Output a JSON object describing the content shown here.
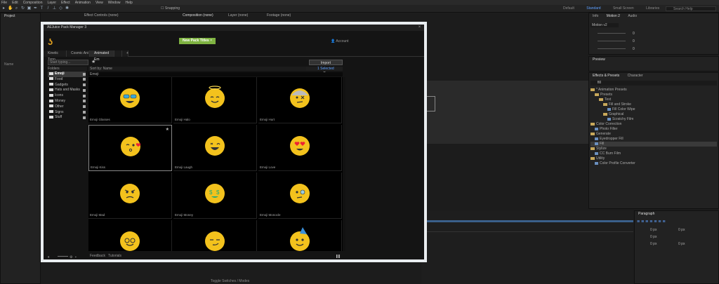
{
  "menu": [
    "File",
    "Edit",
    "Composition",
    "Layer",
    "Effect",
    "Animation",
    "View",
    "Window",
    "Help"
  ],
  "toolbar": {
    "snapping": "Snapping",
    "workspaces": [
      "Default",
      "Standard",
      "Small Screen",
      "Libraries"
    ],
    "search_placeholder": "Search Help"
  },
  "panels": {
    "project_tab": "Project",
    "effect_controls": "Effect Controls (none)",
    "composition": "Composition (none)",
    "layer": "Layer (none)",
    "footage": "Footage (none)",
    "name_col": "Name"
  },
  "info_panel": {
    "tabs": [
      "Info",
      "Motion 2",
      "Audio"
    ],
    "preset": "Motion v2",
    "values": [
      "0",
      "0",
      "0"
    ]
  },
  "preview_panel": {
    "title": "Preview"
  },
  "effects_panel": {
    "tabs": [
      "Effects & Presets",
      "Character"
    ],
    "search": "fill",
    "tree": [
      {
        "label": "* Animation Presets",
        "indent": 0,
        "type": "folder"
      },
      {
        "label": "Presets",
        "indent": 1,
        "type": "folder"
      },
      {
        "label": "Text",
        "indent": 2,
        "type": "folder"
      },
      {
        "label": "Fill and Stroke",
        "indent": 3,
        "type": "folder"
      },
      {
        "label": "Fill Color Wipe",
        "indent": 4,
        "type": "fx"
      },
      {
        "label": "Graphical",
        "indent": 3,
        "type": "folder"
      },
      {
        "label": "Scratchy Film",
        "indent": 4,
        "type": "fx"
      },
      {
        "label": "Color Correction",
        "indent": 0,
        "type": "folder"
      },
      {
        "label": "Photo Filter",
        "indent": 1,
        "type": "fx"
      },
      {
        "label": "Generate",
        "indent": 0,
        "type": "folder"
      },
      {
        "label": "Eyedropper Fill",
        "indent": 1,
        "type": "fx"
      },
      {
        "label": "Fill",
        "indent": 1,
        "type": "fx"
      },
      {
        "label": "Stylize",
        "indent": 0,
        "type": "folder"
      },
      {
        "label": "CC Burn Film",
        "indent": 1,
        "type": "fx"
      },
      {
        "label": "Utility",
        "indent": 0,
        "type": "folder"
      },
      {
        "label": "Color Profile Converter",
        "indent": 1,
        "type": "fx"
      }
    ]
  },
  "paragraph_panel": {
    "title": "Paragraph",
    "px_values": [
      "0 px",
      "0 px",
      "0 px",
      "0 px",
      "0 px"
    ]
  },
  "timeline": {
    "footer": "Toggle Switches / Modes"
  },
  "dialog": {
    "title": "AEJuice Pack Manager 3",
    "new_pack": "New Pack Titles",
    "account": "Account",
    "tabs": [
      "Kinetic Typo",
      "Cosmic Ani",
      "Animated Em",
      ""
    ],
    "add_tab": "+",
    "search_placeholder": "Start typing...",
    "import": "Import",
    "folders_header": "Folders",
    "sort_by": "Sort by: Name",
    "selected": "1 Selected",
    "folders": [
      "Emoji",
      "Food",
      "Gadgets",
      "Hats and Masks",
      "Icons",
      "Money",
      "Other",
      "Signs",
      "Stuff"
    ],
    "grid_header": "Emoji",
    "items": [
      {
        "label": "Emoji Glasses",
        "kind": "glasses"
      },
      {
        "label": "Emoji Halo",
        "kind": "halo"
      },
      {
        "label": "Emoji Hurt",
        "kind": "hurt"
      },
      {
        "label": "Emoji Kiss",
        "kind": "kiss",
        "selected": true
      },
      {
        "label": "Emoji Laugh",
        "kind": "laugh"
      },
      {
        "label": "Emoji Love",
        "kind": "love"
      },
      {
        "label": "Emoji Mad",
        "kind": "mad"
      },
      {
        "label": "Emoji Money",
        "kind": "money"
      },
      {
        "label": "Emoji Monocle",
        "kind": "monocle"
      },
      {
        "label": "",
        "kind": "nerd"
      },
      {
        "label": "",
        "kind": "smirk"
      },
      {
        "label": "",
        "kind": "party"
      }
    ],
    "feedback": "Feedback",
    "tutorials": "Tutorials"
  }
}
